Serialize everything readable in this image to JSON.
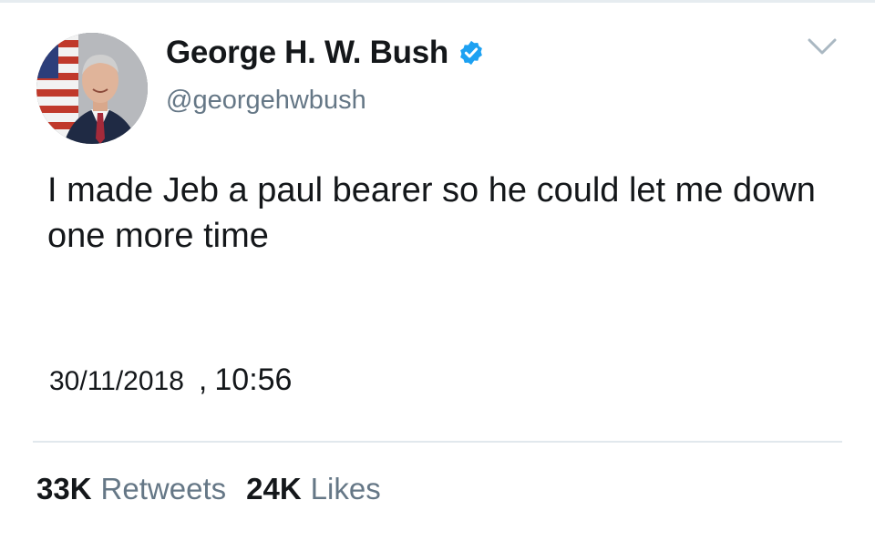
{
  "tweet": {
    "author": {
      "display_name": "George H. W. Bush",
      "handle": "@georgehwbush",
      "verified": true,
      "verified_icon": "verified-badge-icon"
    },
    "text": "I made Jeb a paul bearer so he could let me down one more time",
    "timestamp": {
      "date": "30/11/2018",
      "separator": ",",
      "time": "10:56"
    },
    "stats": {
      "retweets_count": "33K",
      "retweets_label": "Retweets",
      "likes_count": "24K",
      "likes_label": "Likes"
    },
    "menu_icon": "chevron-down-icon"
  },
  "colors": {
    "text_primary": "#14171a",
    "text_secondary": "#657786",
    "verified_blue": "#1da1f2",
    "divider": "#e1e8ed"
  }
}
